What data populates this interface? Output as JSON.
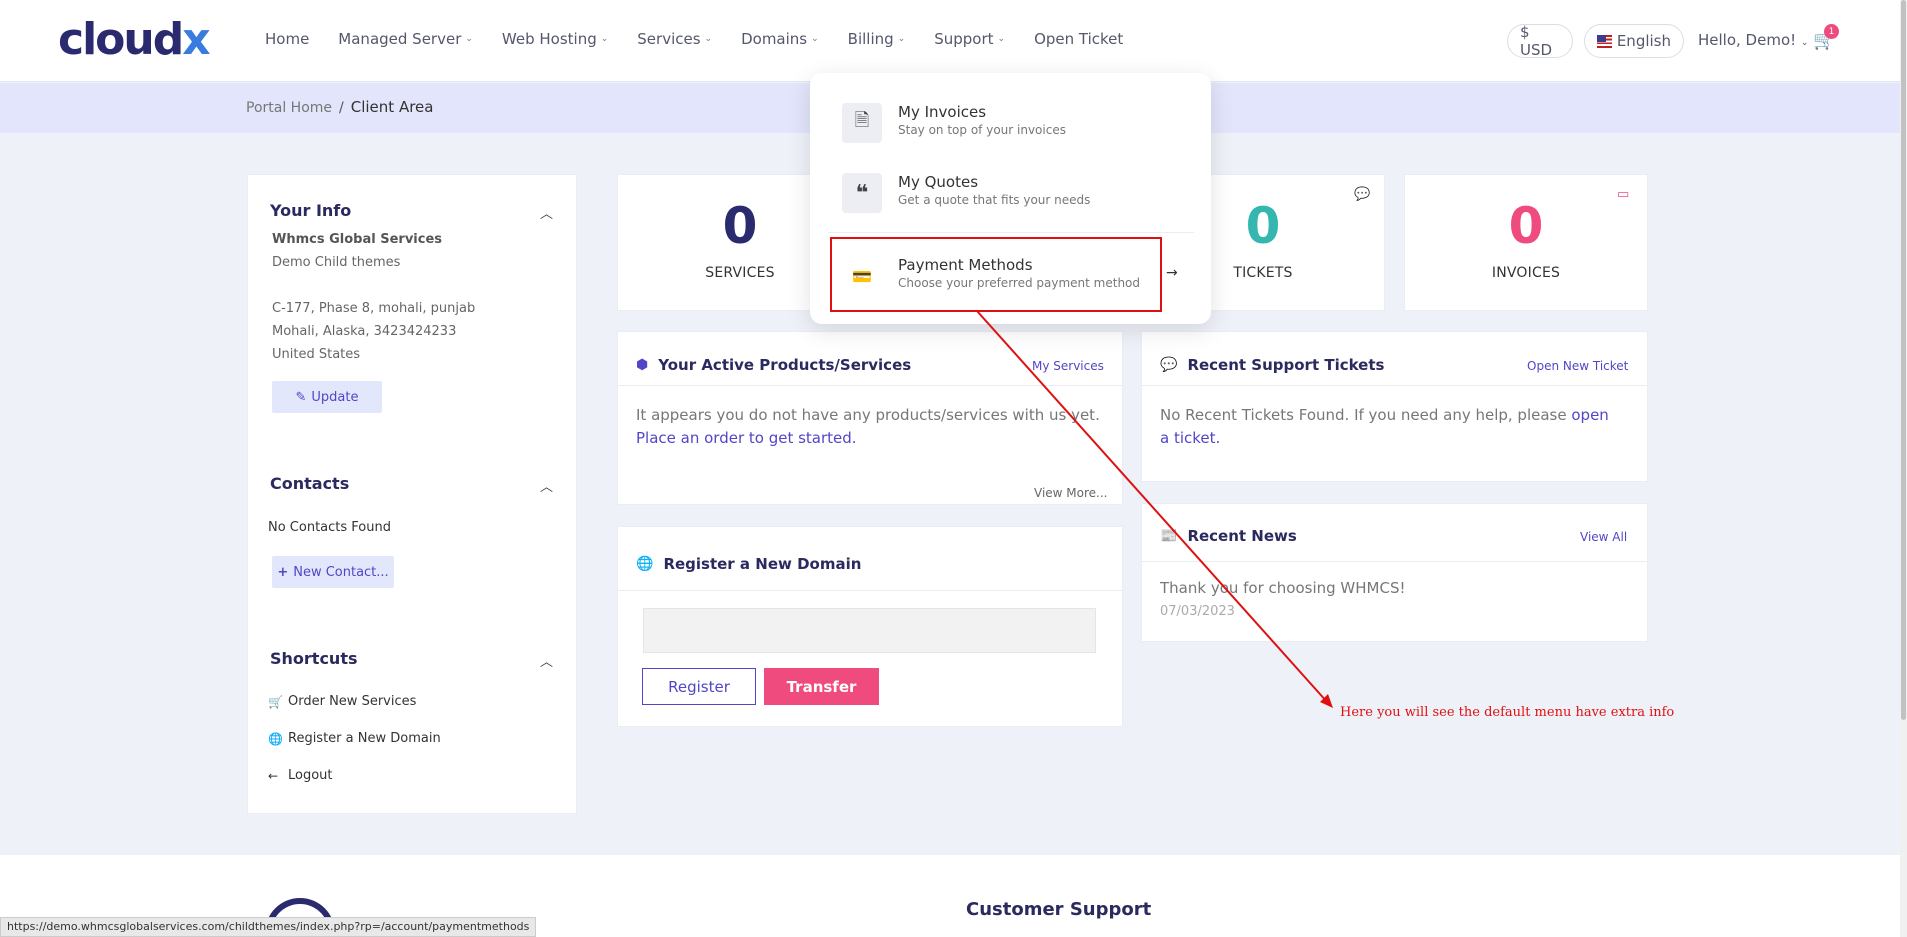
{
  "header": {
    "logo": {
      "text": "cloud",
      "accent": "x"
    },
    "nav": [
      {
        "label": "Home",
        "dropdown": false
      },
      {
        "label": "Managed Server",
        "dropdown": true
      },
      {
        "label": "Web Hosting",
        "dropdown": true
      },
      {
        "label": "Services",
        "dropdown": true
      },
      {
        "label": "Domains",
        "dropdown": true
      },
      {
        "label": "Billing",
        "dropdown": true
      },
      {
        "label": "Support",
        "dropdown": true
      },
      {
        "label": "Open Ticket",
        "dropdown": false
      }
    ],
    "currency": "$ USD",
    "language": "English",
    "greeting": "Hello, Demo!",
    "cart_count": "1"
  },
  "breadcrumb": {
    "home": "Portal Home",
    "separator": "/",
    "current": "Client Area"
  },
  "sidebar": {
    "your_info": {
      "title": "Your Info",
      "company": "Whmcs Global Services",
      "name": "Demo Child themes",
      "address1": "C-177, Phase 8, mohali, punjab",
      "address2": "Mohali, Alaska, 3423424233",
      "country": "United States",
      "update_label": "Update"
    },
    "contacts": {
      "title": "Contacts",
      "empty": "No Contacts Found",
      "new_label": "New Contact..."
    },
    "shortcuts": {
      "title": "Shortcuts",
      "items": [
        "Order New Services",
        "Register a New Domain",
        "Logout"
      ]
    }
  },
  "stats": {
    "services": {
      "value": "0",
      "label": "SERVICES"
    },
    "tickets": {
      "value": "0",
      "label": "TICKETS"
    },
    "invoices": {
      "value": "0",
      "label": "INVOICES"
    }
  },
  "products_panel": {
    "title": "Your Active Products/Services",
    "link": "My Services",
    "text": "It appears you do not have any products/services with us yet.",
    "cta": "Place an order to get started.",
    "view_more": "View More..."
  },
  "tickets_panel": {
    "title": "Recent Support Tickets",
    "link": "Open New Ticket",
    "text": "No Recent Tickets Found. If you need any help, please",
    "cta": "open a ticket."
  },
  "domain_panel": {
    "title": "Register a New Domain",
    "register": "Register",
    "transfer": "Transfer"
  },
  "news_panel": {
    "title": "Recent News",
    "link": "View All",
    "headline": "Thank you for choosing WHMCS!",
    "date": "07/03/2023"
  },
  "billing_dropdown": {
    "items": [
      {
        "label": "My Invoices",
        "sub": "Stay on top of your invoices"
      },
      {
        "label": "My Quotes",
        "sub": "Get a quote that fits your needs"
      },
      {
        "label": "Payment Methods",
        "sub": "Choose your preferred payment method"
      }
    ]
  },
  "annotation": "Here you will see the default menu have extra info",
  "footer": {
    "title": "Customer Support"
  },
  "status_url": "https://demo.whmcsglobalservices.com/childthemes/index.php?rp=/account/paymentmethods",
  "colors": {
    "primary": "#5146c8",
    "teal": "#35b7b0",
    "pink": "#ef4b7e",
    "navy": "#2a2a6e",
    "annotation": "#e01010"
  }
}
